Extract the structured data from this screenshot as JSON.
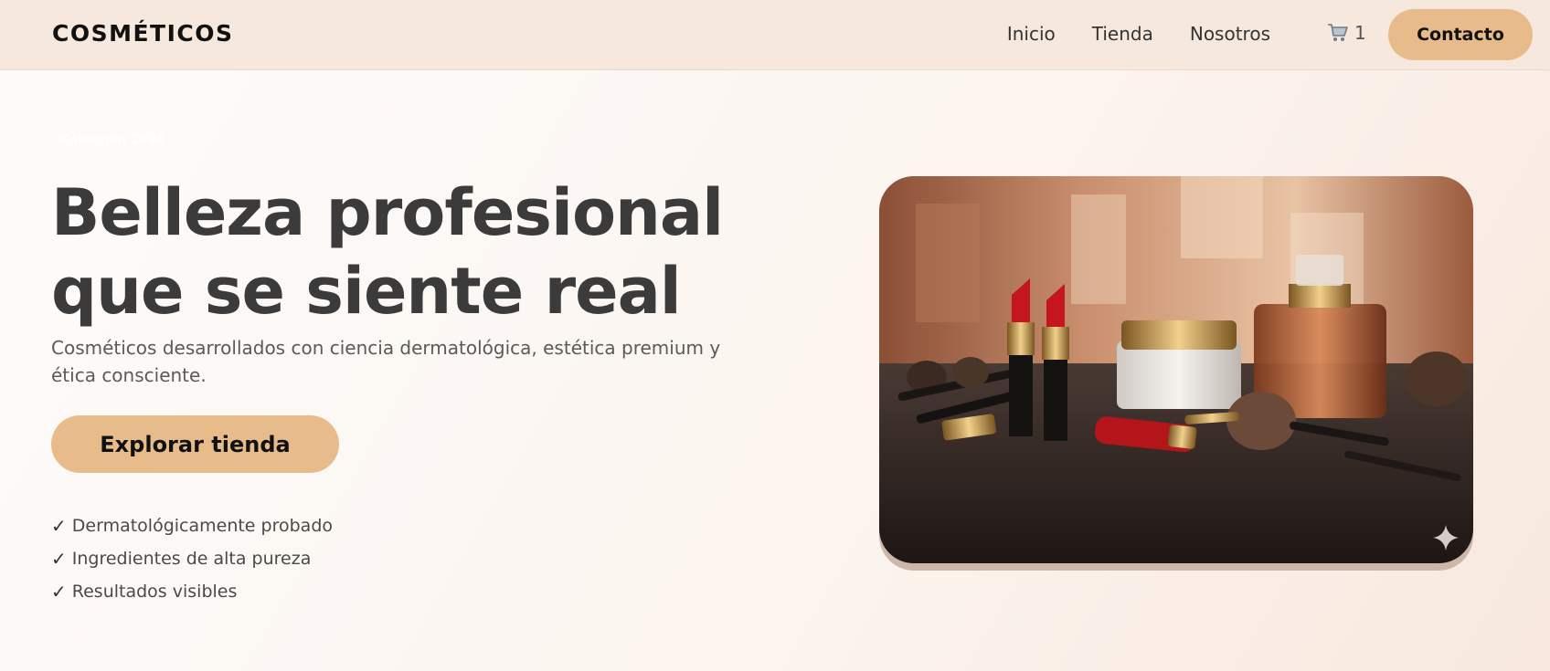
{
  "nav": {
    "brand": "COSMÉTICOS",
    "links": [
      "Inicio",
      "Tienda",
      "Nosotros"
    ],
    "cart_count": "1",
    "contact_label": "Contacto"
  },
  "hero": {
    "eyebrow": "Colección 2026",
    "title_line1": "Belleza profesional",
    "title_line2": "que se siente real",
    "description": "Cosméticos desarrollados con ciencia dermatológica, estética premium y ética consciente.",
    "cta_label": "Explorar tienda",
    "features": [
      "Dermatológicamente probado",
      "Ingredientes de alta pureza",
      "Resultados visibles"
    ],
    "check_glyph": "✓"
  },
  "image": {
    "subject": "cosmetics-product-photo",
    "sparkle_icon": "sparkle-icon"
  },
  "colors": {
    "accent": "#e8bc8a",
    "nav_bg": "#f7e8de",
    "title": "#3b3b3b"
  }
}
